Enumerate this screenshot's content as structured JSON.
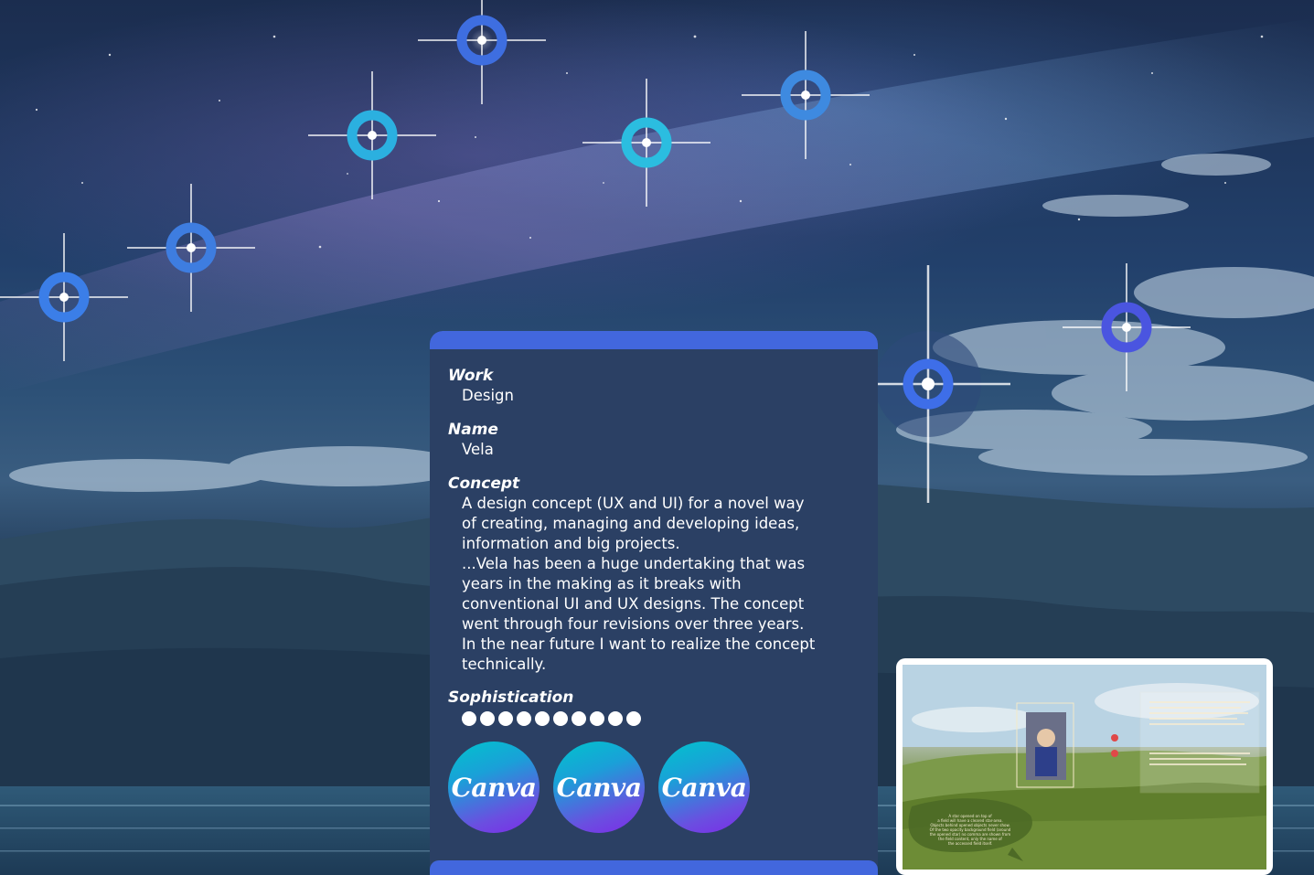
{
  "stars": [
    {
      "id": "star-1",
      "color": "#3e6ee0"
    },
    {
      "id": "star-2",
      "color": "#2bb0e0"
    },
    {
      "id": "star-3",
      "color": "#3e7de0"
    },
    {
      "id": "star-4",
      "color": "#2bbde0"
    },
    {
      "id": "star-5",
      "color": "#3e8ae0"
    },
    {
      "id": "star-6",
      "color": "#3b7ee8"
    },
    {
      "id": "star-7",
      "color": "#3e6ee8",
      "selected": true
    },
    {
      "id": "star-8",
      "color": "#4a55e0"
    }
  ],
  "card": {
    "work_label": "Work",
    "work_value": "Design",
    "name_label": "Name",
    "name_value": "Vela",
    "concept_label": "Concept",
    "concept_value": "A design concept (UX and UI) for a novel way\nof creating, managing and developing ideas,\ninformation and big projects.\n...Vela has been a huge undertaking that was\nyears in the making as it breaks with\nconventional UI and UX designs. The concept\nwent through four revisions over three years.\nIn the near future I want to realize the concept\ntechnically.",
    "sophistication_label": "Sophistication",
    "sophistication_level": 10,
    "sophistication_max": 10,
    "buttons": [
      {
        "label": "Canva"
      },
      {
        "label": "Canva"
      },
      {
        "label": "Canva"
      }
    ],
    "accent_color": "#4267dd",
    "background_color": "#2b4064"
  },
  "preview": {
    "note_text": "A star opened on top of\na field will have a cleared star-area.\nObjects behind opened objects never show.\nOf the two opacity background field (around\nthe opened star) no comma are shown from\nthe field content, only the name of\nthe accessed field itself."
  }
}
